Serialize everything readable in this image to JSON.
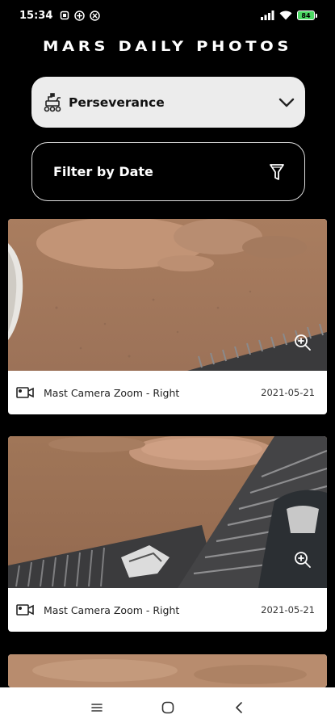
{
  "status_bar": {
    "time": "15:34",
    "battery": "84",
    "left_icons": [
      "notification-icon",
      "vpn-icon",
      "sync-icon"
    ],
    "right_icons": [
      "signal-icon",
      "wifi-icon",
      "battery-icon"
    ]
  },
  "app": {
    "title": "MARS DAILY PHOTOS"
  },
  "rover_select": {
    "value": "Perseverance",
    "icon": "rover-icon"
  },
  "filter": {
    "label": "Filter by Date",
    "icon": "funnel-icon"
  },
  "photos": [
    {
      "camera": "Mast Camera Zoom - Right",
      "date": "2021-05-21"
    },
    {
      "camera": "Mast Camera Zoom - Right",
      "date": "2021-05-21"
    }
  ],
  "nav_bar": {
    "icons": [
      "menu-icon",
      "home-icon",
      "back-icon"
    ]
  },
  "colors": {
    "background": "#000000",
    "card": "#ffffff",
    "select_bg": "#ececec",
    "mars_sand": "#b5856a"
  }
}
